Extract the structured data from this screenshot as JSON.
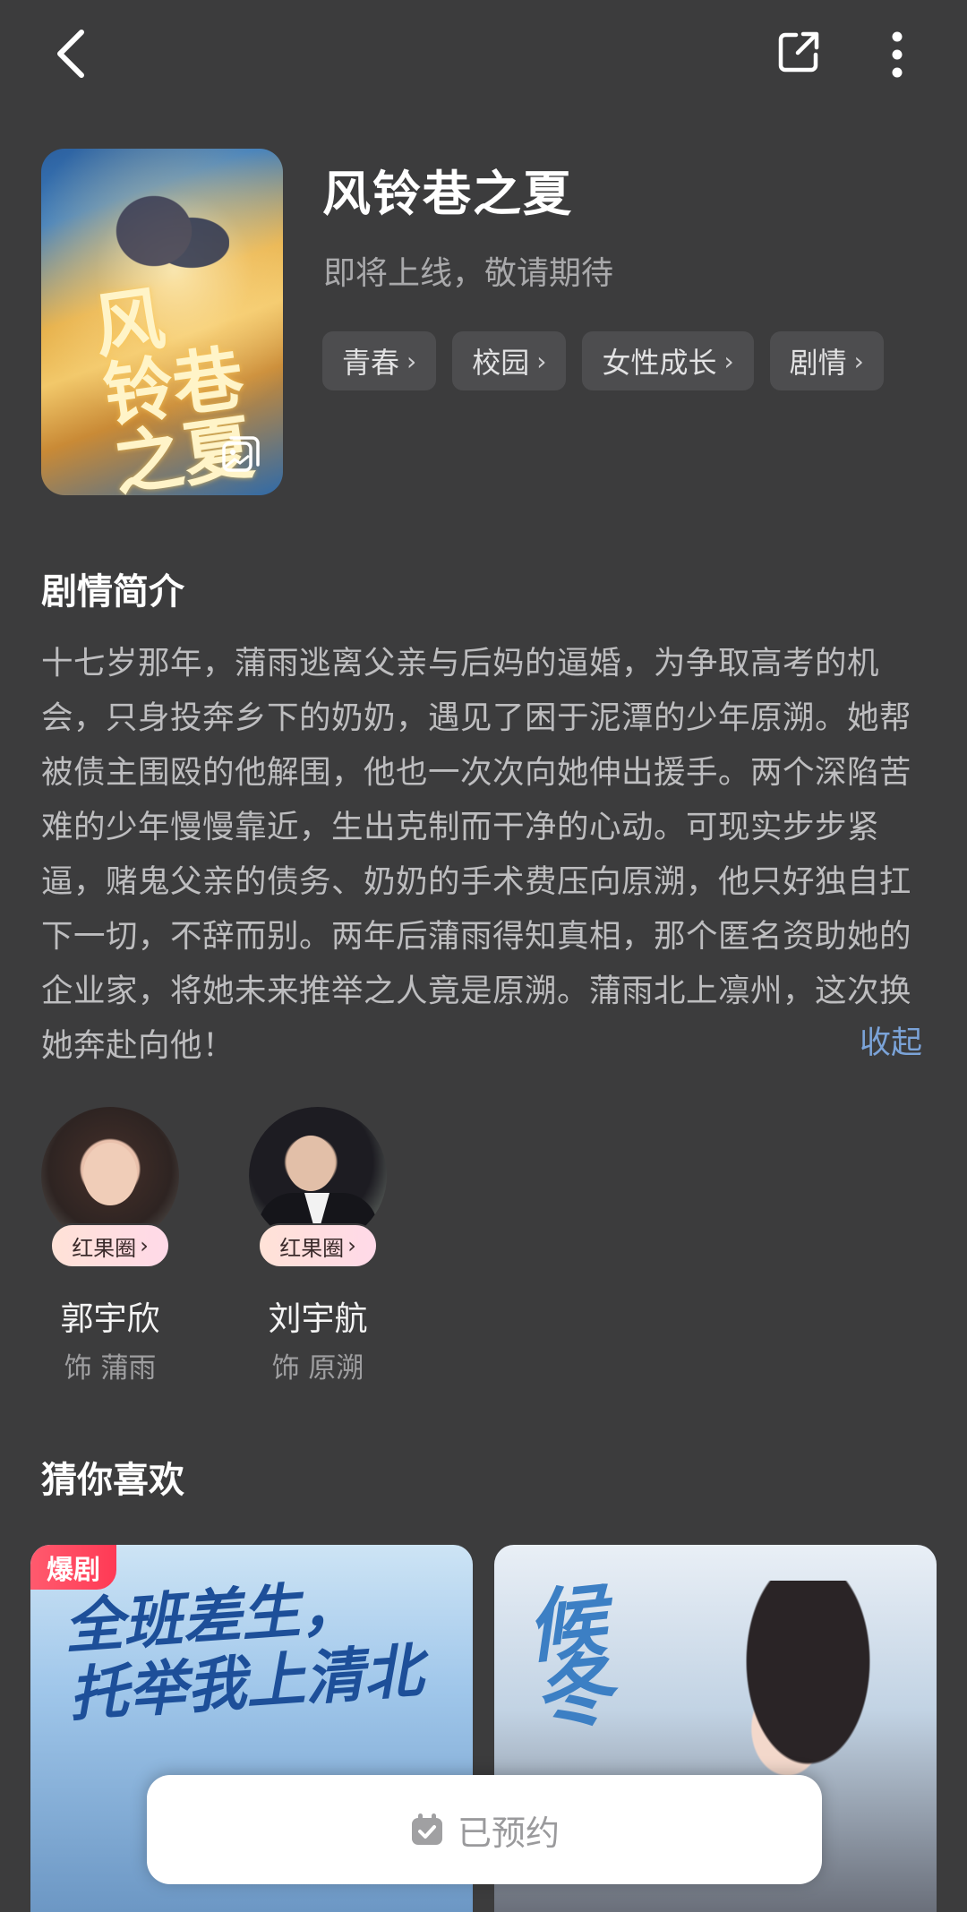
{
  "header": {
    "back_icon": "back-arrow-icon",
    "share_icon": "share-icon",
    "more_icon": "more-vertical-icon"
  },
  "show": {
    "poster_text": [
      "风",
      "铃巷",
      "之夏"
    ],
    "title": "风铃巷之夏",
    "status": "即将上线，敬请期待",
    "tags": [
      "青春",
      "校园",
      "女性成长",
      "剧情"
    ]
  },
  "synopsis": {
    "heading": "剧情简介",
    "text": "十七岁那年，蒲雨逃离父亲与后妈的逼婚，为争取高考的机会，只身投奔乡下的奶奶，遇见了困于泥潭的少年原溯。她帮被债主围殴的他解围，他也一次次向她伸出援手。两个深陷苦难的少年慢慢靠近，生出克制而干净的心动。可现实步步紧逼，赌鬼父亲的债务、奶奶的手术费压向原溯，他只好独自扛下一切，不辞而别。两年后蒲雨得知真相，那个匿名资助她的企业家，将她未来推举之人竟是原溯。蒲雨北上凛州，这次换她奔赴向他！",
    "collapse_label": "收起"
  },
  "cast": [
    {
      "badge": "红果圈",
      "name": "郭宇欣",
      "role": "饰 蒲雨"
    },
    {
      "badge": "红果圈",
      "name": "刘宇航",
      "role": "饰 原溯"
    }
  ],
  "recommend": {
    "heading": "猜你喜欢",
    "cards": [
      {
        "badge": "爆剧",
        "poster_title_lines": [
          "全班差生，",
          "托举我上清北"
        ]
      },
      {
        "badge": "",
        "poster_title_lines": [
          "候",
          "冬"
        ]
      }
    ]
  },
  "reserve_button": {
    "label": "已预约",
    "icon": "calendar-check-icon"
  },
  "colors": {
    "background": "#3c3c3d",
    "tag_bg": "#4d4d4f",
    "link": "#7ba3d8",
    "hot_badge": "#ff3a55"
  }
}
